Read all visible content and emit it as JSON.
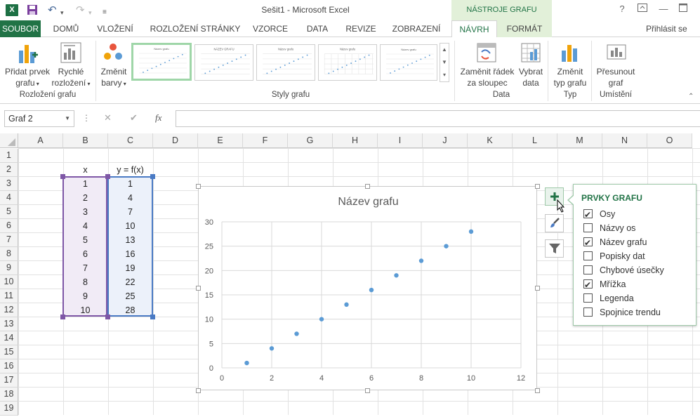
{
  "window": {
    "title": "Sešit1 - Microsoft Excel",
    "context_group": "NÁSTROJE GRAFU",
    "help": "?",
    "excel_badge": "X"
  },
  "tabs": {
    "file": "SOUBOR",
    "items": [
      "DOMŮ",
      "VLOŽENÍ",
      "ROZLOŽENÍ STRÁNKY",
      "VZORCE",
      "DATA",
      "REVIZE",
      "ZOBRAZENÍ"
    ],
    "navrh": "NÁVRH",
    "format": "FORMÁT",
    "sign_in": "Přihlásit se"
  },
  "ribbon": {
    "add_element": [
      "Přidat prvek",
      "grafu"
    ],
    "quick_layout": [
      "Rychlé",
      "rozložení"
    ],
    "change_colors": [
      "Změnit",
      "barvy"
    ],
    "switch_row_col": [
      "Zaměnit řádek",
      "za sloupec"
    ],
    "select_data": [
      "Vybrat",
      "data"
    ],
    "change_type": [
      "Změnit",
      "typ grafu"
    ],
    "move_chart": [
      "Přesunout",
      "graf"
    ],
    "groups": {
      "layouts": "Rozložení grafu",
      "styles": "Styly grafu",
      "data": "Data",
      "type": "Typ",
      "location": "Umístění"
    },
    "style_thumb_titles": [
      "Název grafu",
      "NÁZEV GRAFU",
      "Název grafu",
      "Název grafu",
      "Název grafu"
    ]
  },
  "formula": {
    "name_box": "Graf 2",
    "fx": "fx",
    "cancel": "✕",
    "enter": "✔",
    "more": "⋮"
  },
  "columns": [
    "A",
    "B",
    "C",
    "D",
    "E",
    "F",
    "G",
    "H",
    "I",
    "J",
    "K",
    "L",
    "M",
    "N",
    "O"
  ],
  "rows": [
    "1",
    "2",
    "3",
    "4",
    "5",
    "6",
    "7",
    "8",
    "9",
    "10",
    "11",
    "12",
    "13",
    "14",
    "15",
    "16",
    "17",
    "18",
    "19"
  ],
  "table": {
    "header_x": "x",
    "header_y": "y = f(x)",
    "x": [
      "1",
      "2",
      "3",
      "4",
      "5",
      "6",
      "7",
      "8",
      "9",
      "10"
    ],
    "y": [
      "1",
      "4",
      "7",
      "10",
      "13",
      "16",
      "19",
      "22",
      "25",
      "28"
    ]
  },
  "chart_data": {
    "type": "scatter",
    "title": "Název grafu",
    "x": [
      1,
      2,
      3,
      4,
      5,
      6,
      7,
      8,
      9,
      10
    ],
    "y": [
      1,
      4,
      7,
      10,
      13,
      16,
      19,
      22,
      25,
      28
    ],
    "xlim": [
      0,
      12
    ],
    "ylim": [
      0,
      30
    ],
    "xticks": [
      "0",
      "2",
      "4",
      "6",
      "8",
      "10",
      "12"
    ],
    "yticks": [
      "0",
      "5",
      "10",
      "15",
      "20",
      "25",
      "30"
    ],
    "grid": true,
    "color": "#5b9bd5"
  },
  "panel": {
    "title": "PRVKY GRAFU",
    "items": [
      {
        "label": "Osy",
        "checked": true
      },
      {
        "label": "Názvy os",
        "checked": false
      },
      {
        "label": "Název grafu",
        "checked": true
      },
      {
        "label": "Popisky dat",
        "checked": false
      },
      {
        "label": "Chybové úsečky",
        "checked": false
      },
      {
        "label": "Mřížka",
        "checked": true
      },
      {
        "label": "Legenda",
        "checked": false
      },
      {
        "label": "Spojnice trendu",
        "checked": false
      }
    ]
  },
  "colors": {
    "accent": "#217346",
    "point": "#5b9bd5",
    "selection_x": "#7e57a6",
    "selection_y": "#4a7ac4"
  }
}
